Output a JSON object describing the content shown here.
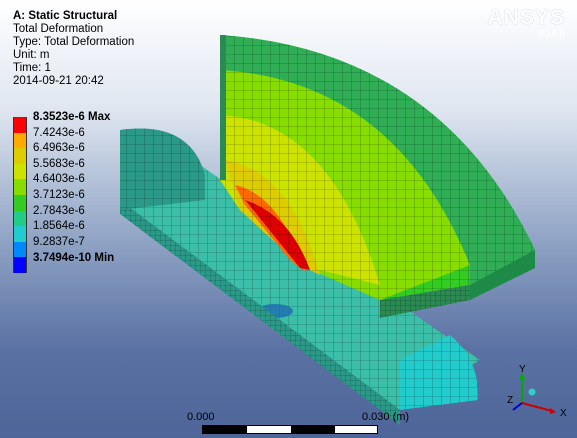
{
  "info": {
    "analysis": "A: Static Structural",
    "result": "Total Deformation",
    "type": "Type: Total Deformation",
    "unit": "Unit: m",
    "time": "Time: 1",
    "date": "2014-09-21 20:42"
  },
  "legend": {
    "max_label": "8.3523e-6 Max",
    "levels": [
      "7.4243e-6",
      "6.4963e-6",
      "5.5683e-6",
      "4.6403e-6",
      "3.7123e-6",
      "2.7843e-6",
      "1.8564e-6",
      "9.2837e-7"
    ],
    "min_label": "3.7494e-10 Min",
    "colors": [
      "#ff0000",
      "#ffaa00",
      "#ddcc00",
      "#cce300",
      "#88dd00",
      "#33cc22",
      "#22cc88",
      "#22cccc",
      "#0088ff",
      "#0000ff"
    ]
  },
  "brand": {
    "name": "ANSYS",
    "version": "R14.5"
  },
  "scale": {
    "start": "0.000",
    "end": "0.030 (m)"
  },
  "triad": {
    "x": "X",
    "y": "Y",
    "z": "Z"
  }
}
